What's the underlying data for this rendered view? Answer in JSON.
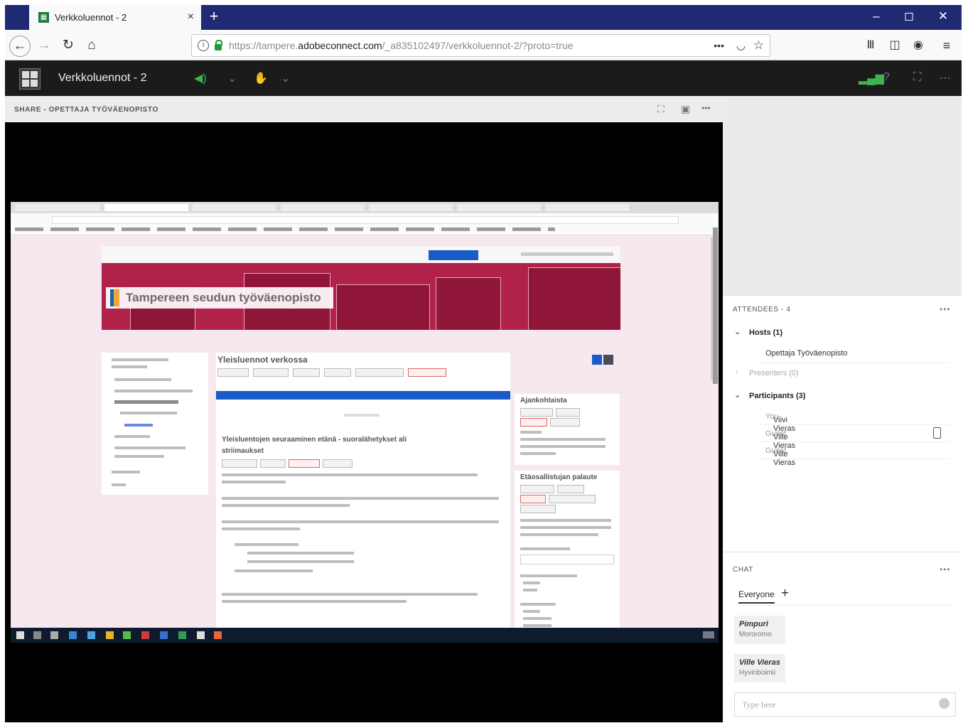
{
  "browser": {
    "tab_title": "Verkkoluennot - 2",
    "tab_close": "×",
    "new_tab": "+",
    "url_prefix": "https://tampere.",
    "url_host": "adobeconnect.com",
    "url_path": "/_a835102497/verkkoluennot-2/?proto=true",
    "url_more": "•••",
    "win_min": "–",
    "win_max": "◻",
    "win_close": "✕"
  },
  "app": {
    "title": "Verkkoluennot - 2"
  },
  "share": {
    "title": "SHARE - OPETTAJA TYÖVÄENOPISTO",
    "more": "•••",
    "screen": {
      "site_name": "Tampereen seudun työväenopisto",
      "course_title": "Yleisluennot verkossa",
      "box1_title": "Ajankohtaista",
      "box2_title": "Etäosallistujan palaute",
      "main_heading_1": "Yleisluentojen seuraaminen etänä - suoralähetykset ali",
      "main_heading_2": "striimaukset"
    }
  },
  "attendees": {
    "header": "ATTENDEES - 4",
    "more": "•••",
    "groups": [
      {
        "label": "Hosts (1)",
        "expanded": true,
        "members": [
          {
            "name": "Opettaja Työväenopisto",
            "role": ""
          }
        ]
      },
      {
        "label": "Presenters (0)",
        "expanded": false,
        "members": []
      },
      {
        "label": "Participants (3)",
        "expanded": true,
        "members": [
          {
            "name": "Viivi Vieras",
            "role": "You"
          },
          {
            "name": "Ville Vieras",
            "role": "Guest"
          },
          {
            "name": "Ville Vieras",
            "role": "Guest"
          }
        ]
      }
    ]
  },
  "chat": {
    "header": "CHAT",
    "more": "•••",
    "tab_everyone": "Everyone",
    "tab_add": "+",
    "messages": [
      {
        "sender": "Pimpuri",
        "text": "Mororomo"
      },
      {
        "sender": "Ville Vieras",
        "text": "Hyvinboimii"
      }
    ],
    "input_placeholder": "Type here"
  },
  "colors": {
    "tabbar": "#1f2a73",
    "appbar": "#1b1b1b",
    "banner": "#b0224a",
    "accent_green": "#1c9c30"
  }
}
